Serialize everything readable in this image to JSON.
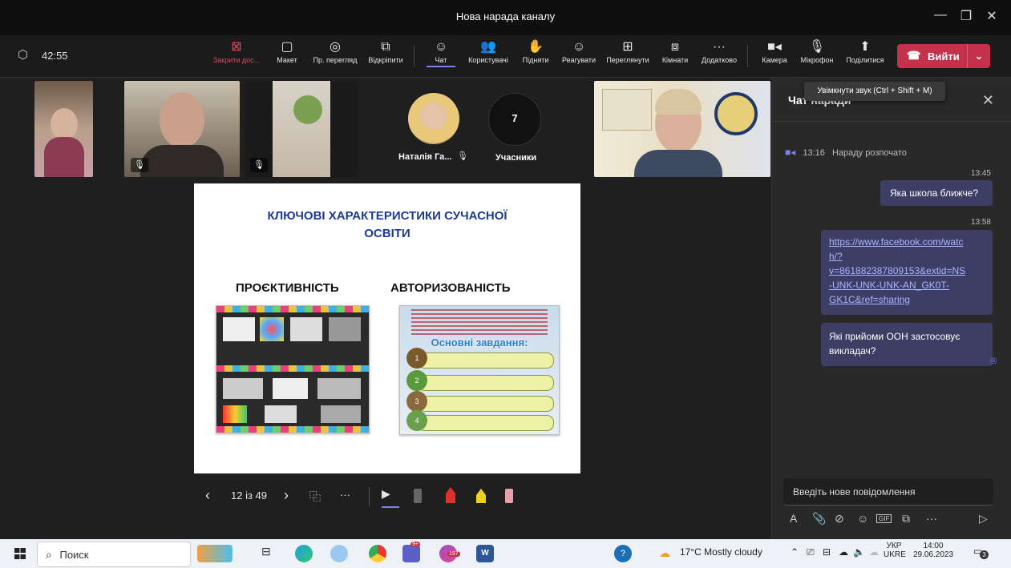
{
  "window": {
    "title": "Нова нарада каналу",
    "minimize": "—",
    "maximize": "❐",
    "close": "✕"
  },
  "toolbar": {
    "timer": "42:55",
    "buttons": {
      "stop_share": {
        "label": "Закрити дос...",
        "icon": "⊠"
      },
      "layout": {
        "label": "Макет",
        "icon": "▢"
      },
      "presenter_view": {
        "label": "Пр. перегляд",
        "icon": "◎"
      },
      "undock": {
        "label": "Відкріпити",
        "icon": "⧉"
      },
      "chat": {
        "label": "Чат",
        "icon": "☺"
      },
      "people": {
        "label": "Користувачі",
        "icon": "👥"
      },
      "raise": {
        "label": "Підняти",
        "icon": "✋"
      },
      "react": {
        "label": "Реагувати",
        "icon": "☺"
      },
      "view": {
        "label": "Переглянути",
        "icon": "⊞"
      },
      "rooms": {
        "label": "Кімнати",
        "icon": "⧈"
      },
      "more": {
        "label": "Додатково",
        "icon": "···"
      },
      "camera": {
        "label": "Камера",
        "icon": "■◂"
      },
      "mic": {
        "label": "Мікрофон",
        "icon": "🎙"
      },
      "share": {
        "label": "Поділитися",
        "icon": "⬆"
      }
    },
    "leave": {
      "label": "Вийти",
      "icon": "☎",
      "chevron": "⌄"
    }
  },
  "tooltip": "Увімкнути звук (Ctrl + Shift + M)",
  "participants": {
    "natalia_name": "Наталія Га...",
    "count": "7",
    "count_label": "Учасники"
  },
  "slide": {
    "title_line1": "КЛЮЧОВІ ХАРАКТЕРИСТИКИ СУЧАСНОЇ",
    "title_line2": "ОСВІТИ",
    "heading_left": "ПРОЄКТИВНІСТЬ",
    "heading_right": "АВТОРИЗОВАНІСТЬ",
    "inner_title": "Основні завдання:",
    "inner_rows": [
      "1",
      "2",
      "3",
      "4"
    ]
  },
  "presentation": {
    "prev": "‹",
    "page": "12 із 49",
    "next": "›",
    "more": "···"
  },
  "chat": {
    "title": "Чат наради",
    "close": "✕",
    "system_time": "13:16",
    "system_text": "Нараду розпочато",
    "messages": [
      {
        "time": "13:45",
        "text": "Яка школа ближче?"
      },
      {
        "time": "13:58",
        "link": "https://www.facebook.com/watch/?v=861882387809153&extid=NS-UNK-UNK-UNK-AN_GK0T-GK1C&ref=sharing",
        "link_lines": [
          "https://www.facebook.com/watc",
          "h/?",
          "v=861882387809153&extid=NS",
          "-UNK-UNK-UNK-AN_GK0T-",
          "GK1C&ref=sharing"
        ]
      },
      {
        "text_lines": [
          "Які прийоми ООН застосовує",
          "викладач?"
        ]
      }
    ],
    "compose_placeholder": "Введіть нове повідомлення",
    "tools": [
      "A",
      "📎",
      "⊘",
      "☺",
      "GIF",
      "⧉",
      "···",
      "▷"
    ]
  },
  "taskbar": {
    "search": "Поиск",
    "weather": "17°C Mostly cloudy",
    "lang_top": "УКР",
    "lang_bottom": "UKRE",
    "time": "14:00",
    "date": "29.06.2023",
    "notif_count": "3",
    "badge_197": "197",
    "badge_9": "9+"
  },
  "colors": {
    "accent": "#7b83eb",
    "leave": "#c4314b",
    "bubble": "#3d3e66",
    "slide_title": "#1f3a93"
  }
}
